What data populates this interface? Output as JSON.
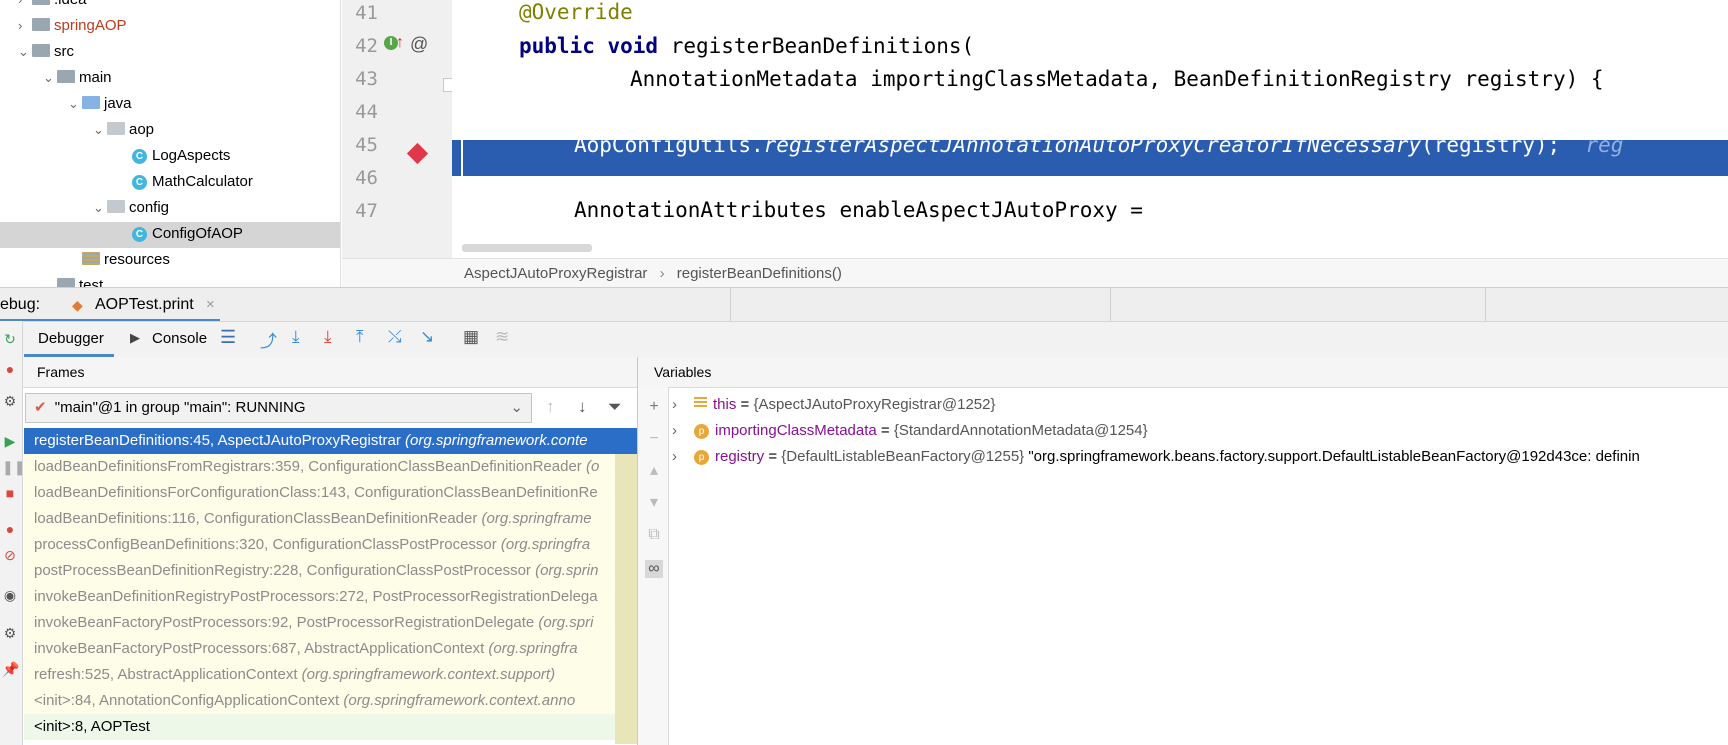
{
  "project_tree": [
    {
      "label": ".idea",
      "depth": 0,
      "arrow": "›",
      "icon": "folder-icon",
      "color": "#000000"
    },
    {
      "label": "springAOP",
      "depth": 0,
      "arrow": "›",
      "icon": "folder-icon",
      "color": "#c0391b"
    },
    {
      "label": "src",
      "depth": 0,
      "arrow": "⌄",
      "icon": "folder-icon",
      "color": "#000000"
    },
    {
      "label": "main",
      "depth": 1,
      "arrow": "⌄",
      "icon": "folder-icon",
      "color": "#000000"
    },
    {
      "label": "java",
      "depth": 2,
      "arrow": "⌄",
      "icon": "source-folder-icon",
      "color": "#000000"
    },
    {
      "label": "aop",
      "depth": 3,
      "arrow": "⌄",
      "icon": "package-icon",
      "color": "#000000"
    },
    {
      "label": "LogAspects",
      "depth": 4,
      "arrow": "",
      "icon": "class-icon",
      "color": "#000000"
    },
    {
      "label": "MathCalculator",
      "depth": 4,
      "arrow": "",
      "icon": "class-icon",
      "color": "#000000"
    },
    {
      "label": "config",
      "depth": 3,
      "arrow": "⌄",
      "icon": "package-icon",
      "color": "#000000"
    },
    {
      "label": "ConfigOfAOP",
      "depth": 4,
      "arrow": "",
      "icon": "class-icon",
      "color": "#000000"
    },
    {
      "label": "resources",
      "depth": 2,
      "arrow": "",
      "icon": "resources-folder-icon",
      "color": "#000000"
    },
    {
      "label": "test",
      "depth": 1,
      "arrow": "⌄",
      "icon": "folder-icon",
      "color": "#000000"
    }
  ],
  "editor": {
    "line_numbers": [
      "41",
      "42",
      "43",
      "44",
      "45",
      "46",
      "47"
    ],
    "lines": {
      "l41": "@Override",
      "l42_kw": "public void",
      "l42_rest": " registerBeanDefinitions(",
      "l43": "AnnotationMetadata importingClassMetadata, BeanDefinitionRegistry registry) {",
      "l45_a": "AopConfigUtils.",
      "l45_b": "registerAspectJAnnotationAutoProxyCreatorIfNecessary",
      "l45_c": "(registry);  ",
      "l45_d": "reg",
      "l47": "AnnotationAttributes enableAspectJAutoProxy ="
    },
    "breadcrumb": [
      "AspectJAutoProxyRegistrar",
      "registerBeanDefinitions()"
    ],
    "breadcrumb_sep": "›"
  },
  "debug": {
    "label": "ebug:",
    "session_tab": "AOPTest.print",
    "tab_close": "×",
    "tabs": {
      "debugger": "Debugger",
      "console": "Console"
    },
    "frames_title": "Frames",
    "variables_title": "Variables",
    "thread_selector": "\"main\"@1 in group \"main\": RUNNING"
  },
  "frames": [
    {
      "method": "registerBeanDefinitions:45, AspectJAutoProxyRegistrar ",
      "pkg": "(org.springframework.conte",
      "state": "selected"
    },
    {
      "method": "loadBeanDefinitionsFromRegistrars:359, ConfigurationClassBeanDefinitionReader ",
      "pkg": "(o",
      "state": "lib"
    },
    {
      "method": "loadBeanDefinitionsForConfigurationClass:143, ConfigurationClassBeanDefinitionRe",
      "pkg": "",
      "state": "lib"
    },
    {
      "method": "loadBeanDefinitions:116, ConfigurationClassBeanDefinitionReader ",
      "pkg": "(org.springframe",
      "state": "lib"
    },
    {
      "method": "processConfigBeanDefinitions:320, ConfigurationClassPostProcessor ",
      "pkg": "(org.springfra",
      "state": "lib"
    },
    {
      "method": "postProcessBeanDefinitionRegistry:228, ConfigurationClassPostProcessor ",
      "pkg": "(org.sprin",
      "state": "lib"
    },
    {
      "method": "invokeBeanDefinitionRegistryPostProcessors:272, PostProcessorRegistrationDelega",
      "pkg": "",
      "state": "lib"
    },
    {
      "method": "invokeBeanFactoryPostProcessors:92, PostProcessorRegistrationDelegate ",
      "pkg": "(org.spri",
      "state": "lib"
    },
    {
      "method": "invokeBeanFactoryPostProcessors:687, AbstractApplicationContext ",
      "pkg": "(org.springfra",
      "state": "lib"
    },
    {
      "method": "refresh:525, AbstractApplicationContext ",
      "pkg": "(org.springframework.context.support)",
      "state": "lib"
    },
    {
      "method": "<init>:84, AnnotationConfigApplicationContext ",
      "pkg": "(org.springframework.context.anno",
      "state": "lib"
    },
    {
      "method": "<init>:8, AOPTest",
      "pkg": "",
      "state": "user"
    }
  ],
  "variables": [
    {
      "icon": "list-icon",
      "name": "this",
      "eq": " = ",
      "value": "{AspectJAutoProxyRegistrar@1252}",
      "extra": ""
    },
    {
      "icon": "param-icon",
      "name": "importingClassMetadata",
      "eq": " = ",
      "value": "{StandardAnnotationMetadata@1254}",
      "extra": ""
    },
    {
      "icon": "param-icon",
      "name": "registry",
      "eq": " = ",
      "value": "{DefaultListableBeanFactory@1255}",
      "extra": " \"org.springframework.beans.factory.support.DefaultListableBeanFactory@192d43ce: definin"
    }
  ],
  "colors": {
    "selection": "#2a6ec8",
    "current_line": "#2a5db0",
    "breakpoint": "#e0384b"
  }
}
